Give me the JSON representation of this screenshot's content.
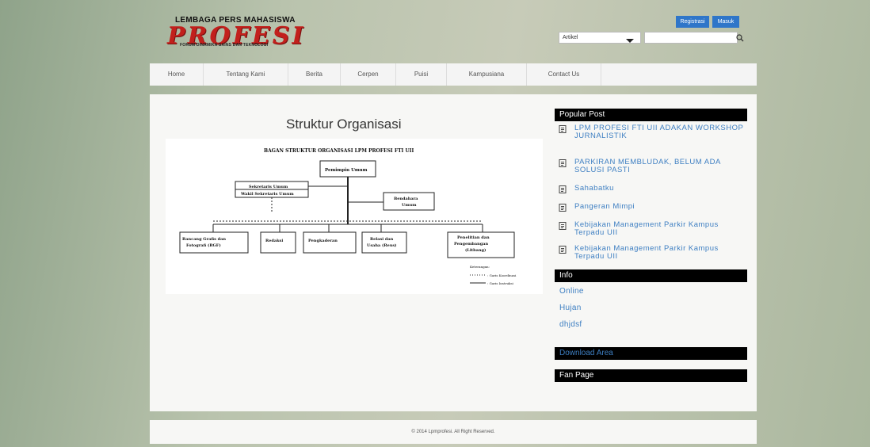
{
  "logo": {
    "line1": "LEMBAGA PERS MAHASISWA",
    "brand": "PROFESI",
    "tagline": "FORUM DINAMIKA SAINS DAN TEKNOLOGI"
  },
  "header": {
    "register_label": "Registrasi",
    "login_label": "Masuk",
    "category_selected": "Artikel",
    "search_placeholder": ""
  },
  "nav": [
    {
      "label": "Home"
    },
    {
      "label": "Tentang Kami"
    },
    {
      "label": "Berita"
    },
    {
      "label": "Cerpen"
    },
    {
      "label": "Puisi"
    },
    {
      "label": "Kampusiana"
    },
    {
      "label": "Contact Us"
    }
  ],
  "main": {
    "title": "Struktur Organisasi",
    "org_chart": {
      "heading": "BAGAN STRUKTUR ORGANISASI LPM PROFESI FTI UII",
      "pemimpin": "Pemimpin Umum",
      "sekretaris": "Sekretaris Umum",
      "wakil_sekretaris": "Wakil Sekretaris Umum",
      "bendahara_1": "Bendahara",
      "bendahara_2": "Umum",
      "rgf_1": "Rancang Grafis dan",
      "rgf_2": "Fotografi (RGF)",
      "redaksi": "Redaksi",
      "pengkaderan": "Pengkaderan",
      "reus_1": "Relasi dan",
      "reus_2": "Usaha (Reus)",
      "litbang_1": "Penelitian dan",
      "litbang_2": "Pengembangan",
      "litbang_3": "(Litbang)",
      "keterangan": "Keterangan:",
      "garis_koordinasi": ": Garis Koordinasi",
      "garis_instruksi": ": Garis Instruksi"
    }
  },
  "sidebar": {
    "popular_title": "Popular Post",
    "posts": [
      {
        "title": "LPM PROFESI FTI UII ADAKAN WORKSHOP JURNALISTIK"
      },
      {
        "title": "PARKIRAN MEMBLUDAK, BELUM ADA SOLUSI PASTI"
      },
      {
        "title": "Sahabatku"
      },
      {
        "title": "Pangeran Mimpi"
      },
      {
        "title": "Kebijakan Management Parkir Kampus Terpadu UII"
      },
      {
        "title": "Kebijakan Management Parkir Kampus Terpadu UII"
      }
    ],
    "info_title": "Info",
    "info_links": [
      {
        "label": "Online"
      },
      {
        "label": "Hujan"
      },
      {
        "label": "dhjdsf"
      }
    ],
    "download_title": "Download Area",
    "fanpage_title": "Fan Page"
  },
  "footer": {
    "text": "© 2014 Lpmprofesi. All Right Reserved."
  },
  "colors": {
    "brand_red": "#c2201c",
    "button_blue": "#2f76c9",
    "link_blue": "#3e7fc2",
    "sidebar_header": "#000000"
  }
}
